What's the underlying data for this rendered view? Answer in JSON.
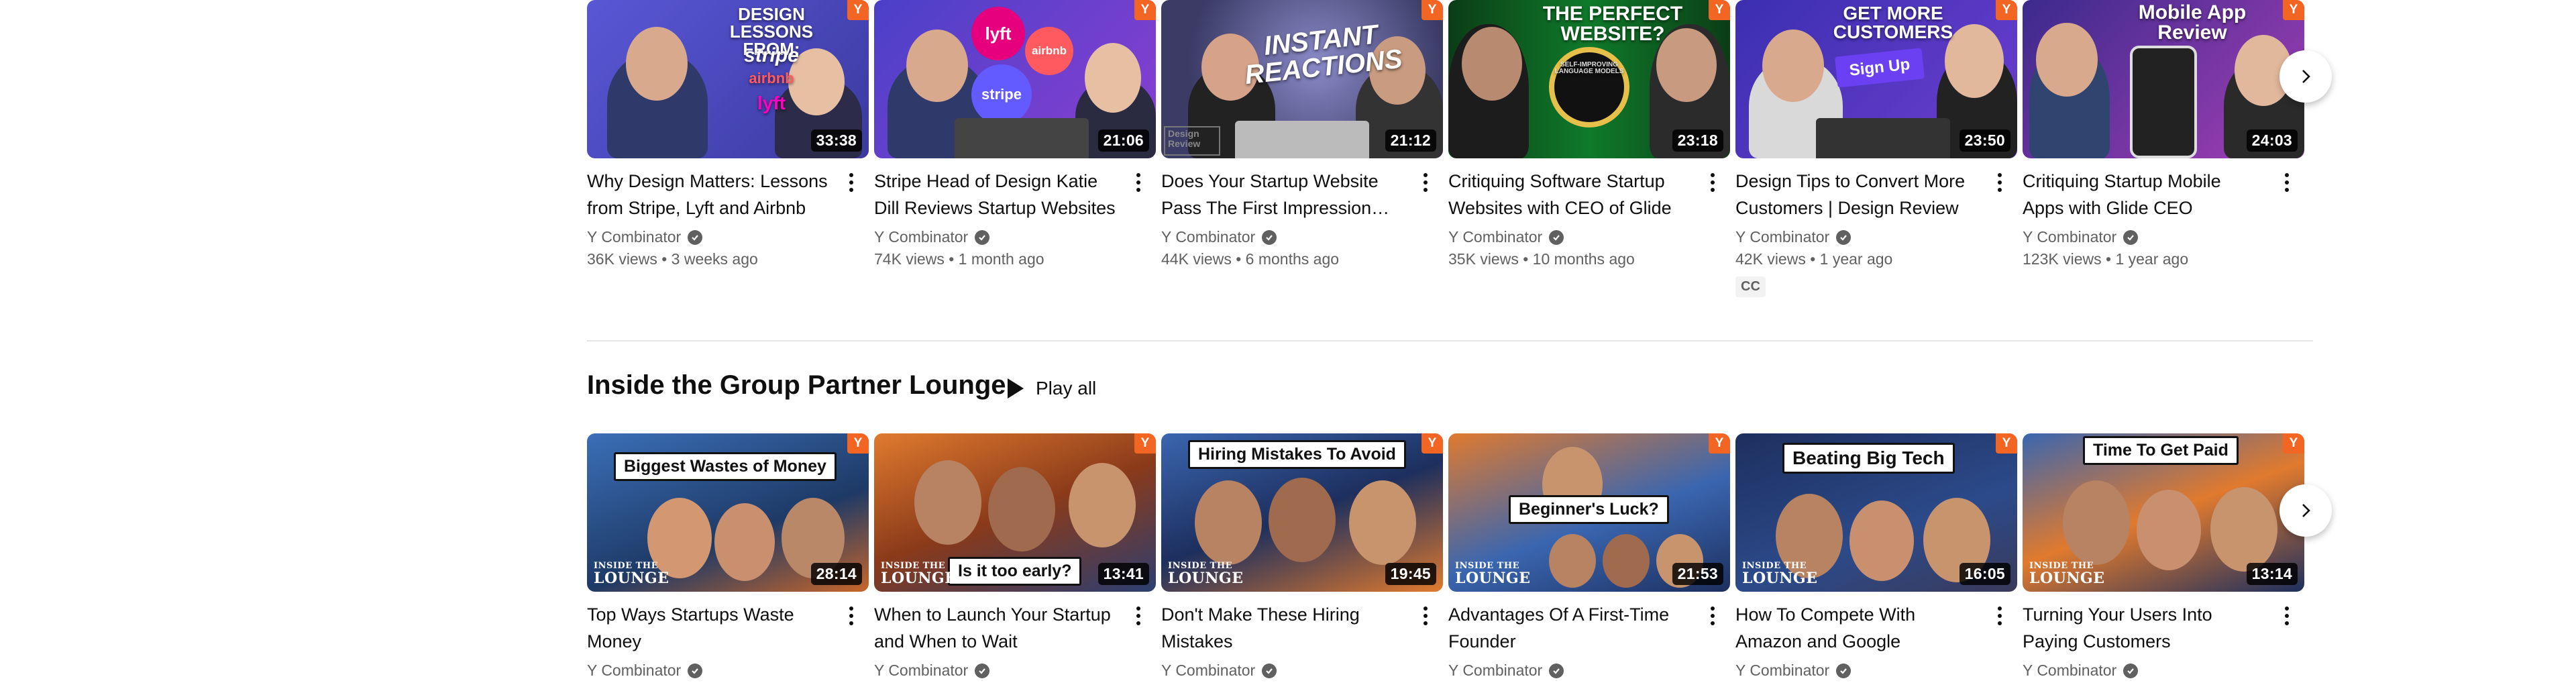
{
  "top_row": [
    {
      "title": "Why Design Matters: Lessons from Stripe, Lyft and Airbnb",
      "channel": "Y Combinator",
      "stats": "36K views • 3 weeks ago",
      "duration": "33:38",
      "thumb_text": "DESIGN LESSONS FROM:",
      "thumb_brands": [
        "stripe",
        "airbnb",
        "lyft"
      ]
    },
    {
      "title": "Stripe Head of Design Katie Dill Reviews Startup Websites",
      "channel": "Y Combinator",
      "stats": "74K views • 1 month ago",
      "duration": "21:06",
      "thumb_brands": [
        "lyft",
        "airbnb",
        "stripe"
      ]
    },
    {
      "title": "Does Your Startup Website Pass The First Impression Test?",
      "channel": "Y Combinator",
      "stats": "44K views • 6 months ago",
      "duration": "21:12",
      "thumb_text": "INSTANT REACTIONS",
      "thumb_small": "Design Review"
    },
    {
      "title": "Critiquing Software Startup Websites with CEO of Glide",
      "channel": "Y Combinator",
      "stats": "35K views • 10 months ago",
      "duration": "23:18",
      "thumb_text": "THE PERFECT WEBSITE?",
      "thumb_sub": "SELF-IMPROVING LANGUAGE MODELS"
    },
    {
      "title": "Design Tips to Convert More Customers | Design Review",
      "channel": "Y Combinator",
      "stats": "42K views • 1 year ago",
      "duration": "23:50",
      "thumb_text": "GET MORE CUSTOMERS",
      "thumb_button": "Sign Up",
      "badge": "CC"
    },
    {
      "title": "Critiquing Startup Mobile Apps with Glide CEO",
      "channel": "Y Combinator",
      "stats": "123K views • 1 year ago",
      "duration": "24:03",
      "thumb_text": "Mobile App Review"
    }
  ],
  "section": {
    "title": "Inside the Group Partner Lounge",
    "play_all": "Play all"
  },
  "bottom_row": [
    {
      "title": "Top Ways Startups Waste Money",
      "channel": "Y Combinator",
      "duration": "28:14",
      "thumb_label": "Biggest Wastes of Money"
    },
    {
      "title": "When to Launch Your Startup and When to Wait",
      "channel": "Y Combinator",
      "duration": "13:41",
      "thumb_label": "Is it too early?"
    },
    {
      "title": "Don't Make These Hiring Mistakes",
      "channel": "Y Combinator",
      "duration": "19:45",
      "thumb_label": "Hiring Mistakes To Avoid"
    },
    {
      "title": "Advantages Of A First-Time Founder",
      "channel": "Y Combinator",
      "duration": "21:53",
      "thumb_label": "Beginner's Luck?"
    },
    {
      "title": "How To Compete With Amazon and Google",
      "channel": "Y Combinator",
      "duration": "16:05",
      "thumb_label": "Beating Big Tech"
    },
    {
      "title": "Turning Your Users Into Paying Customers",
      "channel": "Y Combinator",
      "duration": "13:14",
      "thumb_label": "Time To Get Paid"
    }
  ],
  "lounge_mark": {
    "line1": "INSIDE THE",
    "line2": "LOUNGE"
  },
  "ylogo": "Y",
  "design_review_mark": "Design Review",
  "colors": {
    "yc_orange": "#f26522",
    "text": "#0f0f0f",
    "secondary": "#606060"
  }
}
